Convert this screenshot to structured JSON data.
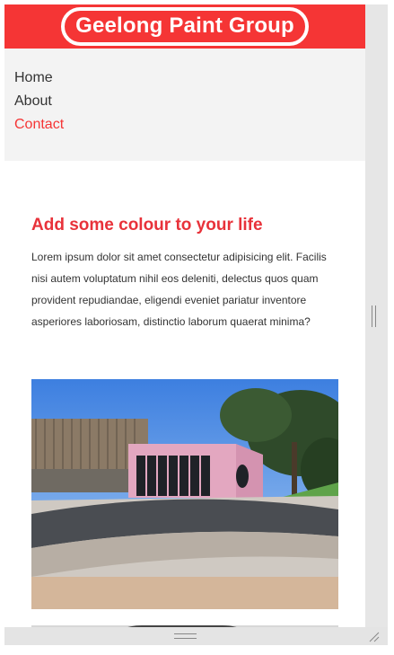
{
  "header": {
    "title": "Geelong Paint Group",
    "bg_color": "#f53535"
  },
  "nav": {
    "items": [
      {
        "label": "Home",
        "active": false
      },
      {
        "label": "About",
        "active": false
      },
      {
        "label": "Contact",
        "active": true
      }
    ],
    "active_color": "#f53535"
  },
  "main": {
    "heading": "Add some colour to your life",
    "body": "Lorem ipsum dolor sit amet consectetur adipisicing elit. Facilis nisi autem voluptatum nihil eos deleniti, delectus quos quam provident repudiandae, eligendi eveniet pariatur inventore asperiores laboriosam, distinctio laborum quaerat minima?"
  },
  "controls": {
    "vertical_scroll_icon": "grip-vertical-icon",
    "horizontal_resize_icon": "grip-horizontal-icon",
    "corner_resize_icon": "resize-corner-icon"
  }
}
